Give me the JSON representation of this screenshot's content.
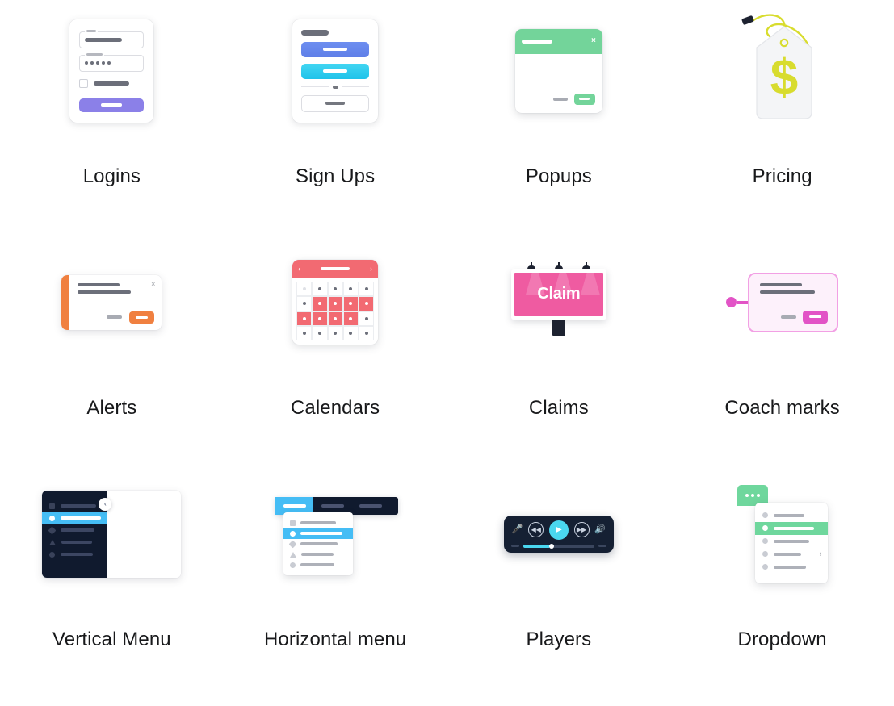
{
  "palette": {
    "purple": "#8b80e8",
    "blue": "#6d8ef0",
    "cyan": "#1fc3ea",
    "green": "#73d49a",
    "orange": "#f08040",
    "red": "#f26a72",
    "pink": "#ef5ba1",
    "magenta": "#e254c6",
    "navy": "#101a2e",
    "sky": "#45bdf5",
    "yellow_green": "#d8dc2e",
    "text": "#18191b"
  },
  "grid": {
    "columns": 4,
    "rows": 3,
    "items": [
      {
        "id": "logins",
        "label": "Logins",
        "icon": "login-form-icon"
      },
      {
        "id": "sign-ups",
        "label": "Sign Ups",
        "icon": "signup-form-icon"
      },
      {
        "id": "popups",
        "label": "Popups",
        "icon": "popup-dialog-icon"
      },
      {
        "id": "pricing",
        "label": "Pricing",
        "icon": "price-tag-icon"
      },
      {
        "id": "alerts",
        "label": "Alerts",
        "icon": "alert-banner-icon"
      },
      {
        "id": "calendars",
        "label": "Calendars",
        "icon": "calendar-icon"
      },
      {
        "id": "claims",
        "label": "Claims",
        "icon": "billboard-icon"
      },
      {
        "id": "coach-marks",
        "label": "Coach marks",
        "icon": "coach-mark-icon"
      },
      {
        "id": "vertical-menu",
        "label": "Vertical Menu",
        "icon": "vertical-menu-icon"
      },
      {
        "id": "horizontal-menu",
        "label": "Horizontal menu",
        "icon": "horizontal-menu-icon"
      },
      {
        "id": "players",
        "label": "Players",
        "icon": "media-player-icon"
      },
      {
        "id": "dropdown",
        "label": "Dropdown",
        "icon": "dropdown-icon"
      }
    ]
  },
  "icons": {
    "popup": {
      "close_glyph": "×"
    },
    "alert": {
      "close_glyph": "×"
    },
    "calendar": {
      "prev_glyph": "‹",
      "next_glyph": "›"
    },
    "claim": {
      "billboard_text": "Claim",
      "lamp_count": 3
    },
    "vertical_menu": {
      "collapse_glyph": "‹",
      "item_count": 5,
      "active_index": 1
    },
    "horizontal_menu": {
      "tab_count": 3,
      "active_tab": 0,
      "panel_item_count": 5,
      "panel_active_index": 1
    },
    "player": {
      "mic_glyph": "🎙",
      "rewind_glyph": "◀◀",
      "play_glyph": "▶",
      "forward_glyph": "▶▶",
      "volume_glyph": "🔊",
      "progress_percent": 38
    },
    "dropdown": {
      "item_count": 5,
      "active_index": 1,
      "chevron_glyph": "›",
      "dots_count": 3
    },
    "pricing": {
      "currency_glyph": "$"
    }
  }
}
